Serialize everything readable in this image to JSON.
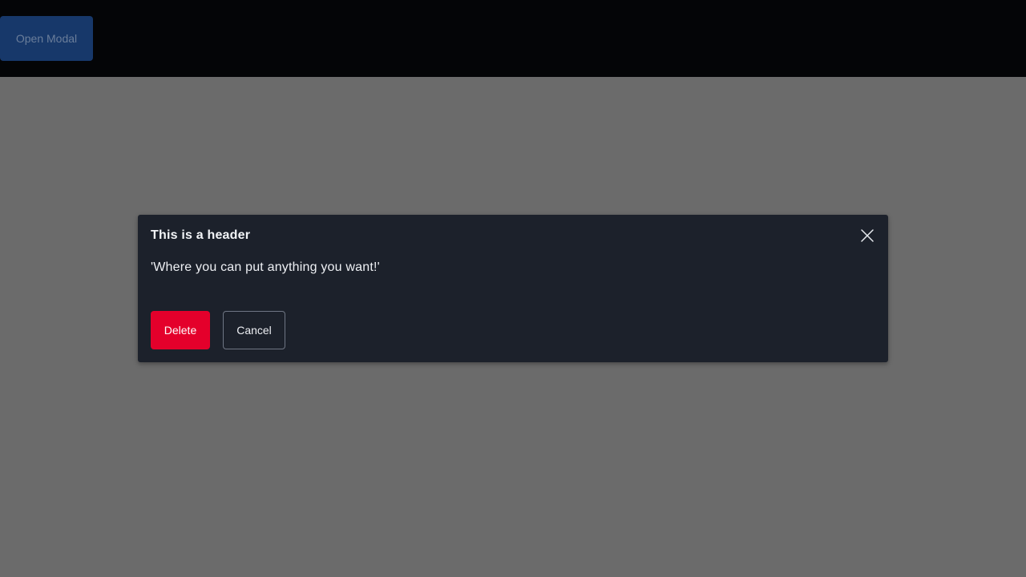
{
  "topbar": {
    "open_modal_label": "Open Modal"
  },
  "modal": {
    "title": "This is a header",
    "body": "'Where you can put anything you want!'",
    "close_icon": "close-icon",
    "delete_label": "Delete",
    "cancel_label": "Cancel"
  },
  "colors": {
    "danger": "#e4002b",
    "modal_background": "#1c212b",
    "primary_button": "#17386a",
    "overlay": "#6b6b6b"
  }
}
